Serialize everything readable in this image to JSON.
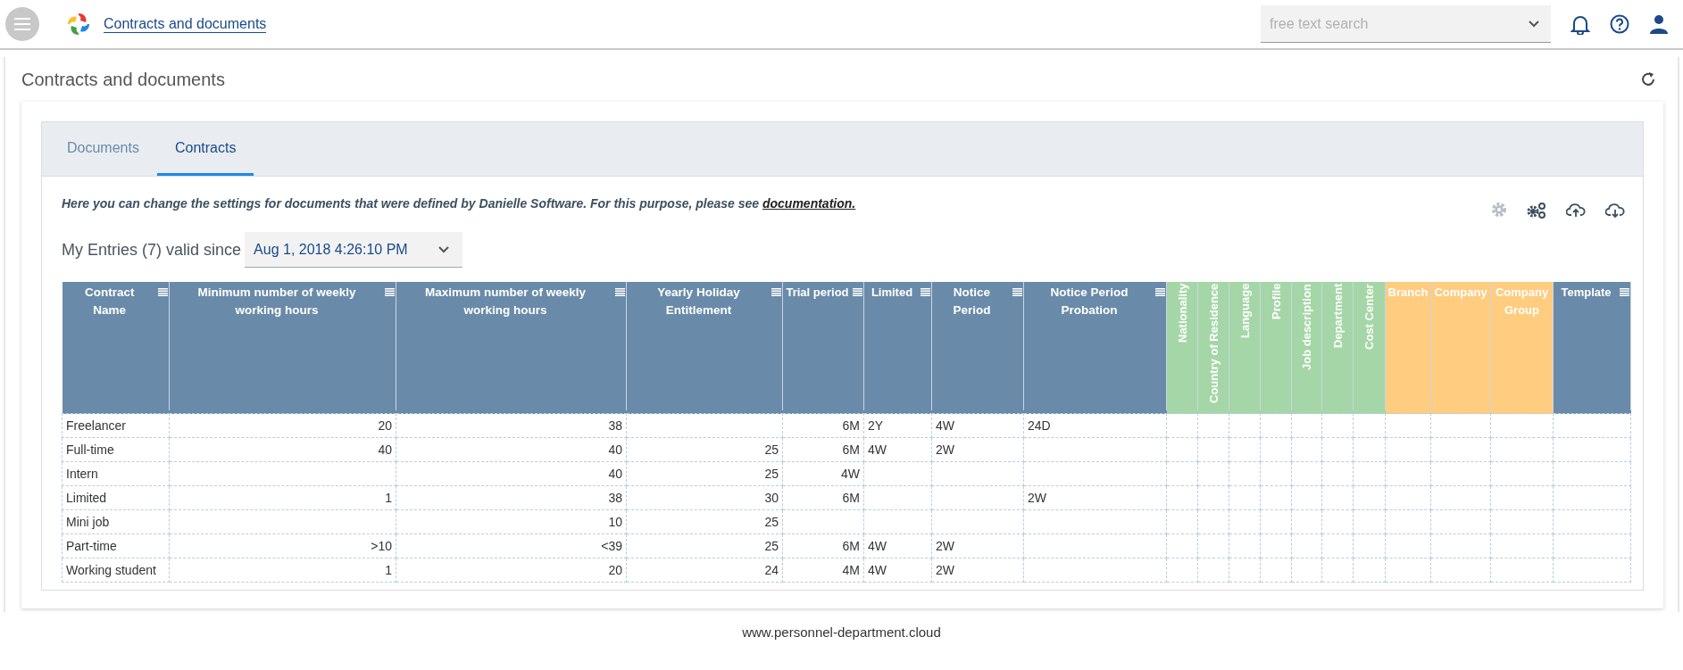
{
  "app_bar": {
    "title": "Contracts and documents",
    "search": {
      "placeholder": "free text search"
    }
  },
  "page": {
    "title": "Contracts and documents"
  },
  "tabs": [
    {
      "label": "Documents",
      "selected": false
    },
    {
      "label": "Contracts",
      "selected": true
    }
  ],
  "description": {
    "text": "Here you can change the settings for documents that were defined by Danielle Software. For this purpose, please see",
    "link": "documentation."
  },
  "toolbar_icons": [
    {
      "kind": "settings",
      "disabled": true
    },
    {
      "kind": "gears",
      "disabled": false
    },
    {
      "kind": "upload",
      "disabled": false
    },
    {
      "kind": "download",
      "disabled": false
    }
  ],
  "entries": {
    "label": "My Entries (7) valid since",
    "date": "Aug 1, 2018 4:26:10 PM"
  },
  "table": {
    "columns": [
      {
        "label": "Contract Name",
        "kind": "text",
        "color": "#6a8aa9",
        "menu": true
      },
      {
        "label": "Minimum number of weekly working hours",
        "kind": "number",
        "color": "#6a8aa9",
        "menu": true
      },
      {
        "label": "Maximum number of weekly working hours",
        "kind": "number",
        "color": "#6a8aa9",
        "menu": true
      },
      {
        "label": "Yearly Holiday Entitlement",
        "kind": "number",
        "color": "#6a8aa9",
        "menu": true
      },
      {
        "label": "Trial period",
        "kind": "number",
        "color": "#6a8aa9",
        "menu": true
      },
      {
        "label": "Limited",
        "kind": "text",
        "color": "#6a8aa9",
        "menu": true
      },
      {
        "label": "Notice Period",
        "kind": "text",
        "color": "#6a8aa9",
        "menu": true
      },
      {
        "label": "Notice Period Probation",
        "kind": "text",
        "color": "#6a8aa9",
        "menu": true
      },
      {
        "label": "Nationality",
        "kind": "vertical",
        "color": "#a5d6a7",
        "menu": false
      },
      {
        "label": "Country of Residence",
        "kind": "vertical",
        "color": "#a5d6a7",
        "menu": false
      },
      {
        "label": "Language",
        "kind": "vertical",
        "color": "#a5d6a7",
        "menu": false
      },
      {
        "label": "Profile",
        "kind": "vertical",
        "color": "#a5d6a7",
        "menu": false
      },
      {
        "label": "Job description",
        "kind": "vertical",
        "color": "#a5d6a7",
        "menu": false
      },
      {
        "label": "Department",
        "kind": "vertical",
        "color": "#a5d6a7",
        "menu": false
      },
      {
        "label": "Cost Center",
        "kind": "vertical",
        "color": "#a5d6a7",
        "menu": false
      },
      {
        "label": "Branch",
        "kind": "text",
        "color": "#ffcc80",
        "menu": false
      },
      {
        "label": "Company",
        "kind": "text",
        "color": "#ffcc80",
        "menu": false
      },
      {
        "label": "Company Group",
        "kind": "text",
        "color": "#ffcc80",
        "menu": false
      },
      {
        "label": "Template",
        "kind": "text",
        "color": "#6a8aa9",
        "menu": true
      }
    ],
    "rows": [
      {
        "cells": [
          "Freelancer",
          "20",
          "38",
          null,
          "6M",
          "2Y",
          "4W",
          "24D",
          null,
          null,
          null,
          null,
          null,
          null,
          null,
          null,
          null,
          null,
          null
        ]
      },
      {
        "cells": [
          "Full-time",
          "40",
          "40",
          "25",
          "6M",
          "4W",
          "2W",
          null,
          null,
          null,
          null,
          null,
          null,
          null,
          null,
          null,
          null,
          null,
          null
        ]
      },
      {
        "cells": [
          "Intern",
          null,
          "40",
          "25",
          "4W",
          null,
          null,
          null,
          null,
          null,
          null,
          null,
          null,
          null,
          null,
          null,
          null,
          null,
          null
        ]
      },
      {
        "cells": [
          "Limited",
          "1",
          "38",
          "30",
          "6M",
          null,
          null,
          "2W",
          null,
          null,
          null,
          null,
          null,
          null,
          null,
          null,
          null,
          null,
          null
        ]
      },
      {
        "cells": [
          "Mini job",
          null,
          "10",
          "25",
          null,
          null,
          null,
          null,
          null,
          null,
          null,
          null,
          null,
          null,
          null,
          null,
          null,
          null,
          null
        ]
      },
      {
        "cells": [
          "Part-time",
          ">10",
          "<39",
          "25",
          "6M",
          "4W",
          "2W",
          null,
          null,
          null,
          null,
          null,
          null,
          null,
          null,
          null,
          null,
          null,
          null
        ]
      },
      {
        "cells": [
          "Working student",
          "1",
          "20",
          "24",
          "4M",
          "4W",
          "2W",
          null,
          null,
          null,
          null,
          null,
          null,
          null,
          null,
          null,
          null,
          null,
          null
        ]
      }
    ]
  },
  "footer": {
    "text": "www.personnel-department.cloud"
  }
}
